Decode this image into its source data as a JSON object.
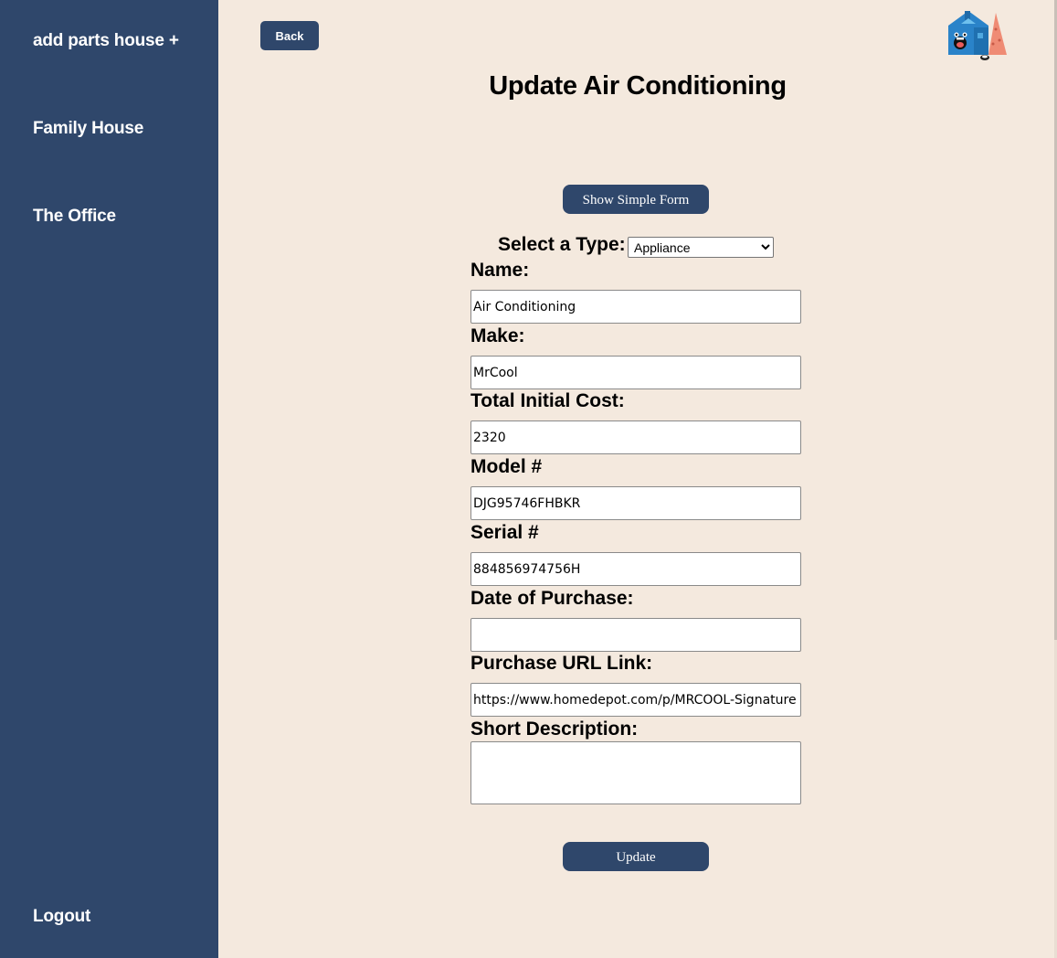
{
  "sidebar": {
    "items": [
      {
        "label": "add parts house +"
      },
      {
        "label": "Family House"
      },
      {
        "label": "The Office"
      }
    ],
    "logout_label": "Logout"
  },
  "header": {
    "back_label": "Back",
    "title": "Update Air Conditioning",
    "logo_icon": "house-mascot-icon"
  },
  "form": {
    "toggle_label": "Show Simple Form",
    "type_label": "Select a Type:",
    "type_selected": "Appliance",
    "fields": {
      "name": {
        "label": "Name:",
        "value": "Air Conditioning"
      },
      "make": {
        "label": "Make:",
        "value": "MrCool"
      },
      "cost": {
        "label": "Total Initial Cost:",
        "value": "2320"
      },
      "model": {
        "label": "Model #",
        "value": "DJG95746FHBKR"
      },
      "serial": {
        "label": "Serial #",
        "value": "884856974756H"
      },
      "date": {
        "label": "Date of Purchase:",
        "value": ""
      },
      "url": {
        "label": "Purchase URL Link:",
        "value": "https://www.homedepot.com/p/MRCOOL-Signature"
      },
      "description": {
        "label": "Short Description:",
        "value": ""
      }
    },
    "submit_label": "Update"
  },
  "colors": {
    "sidebar": "#2f476b",
    "background": "#f4e9de",
    "button": "#2f476b"
  }
}
